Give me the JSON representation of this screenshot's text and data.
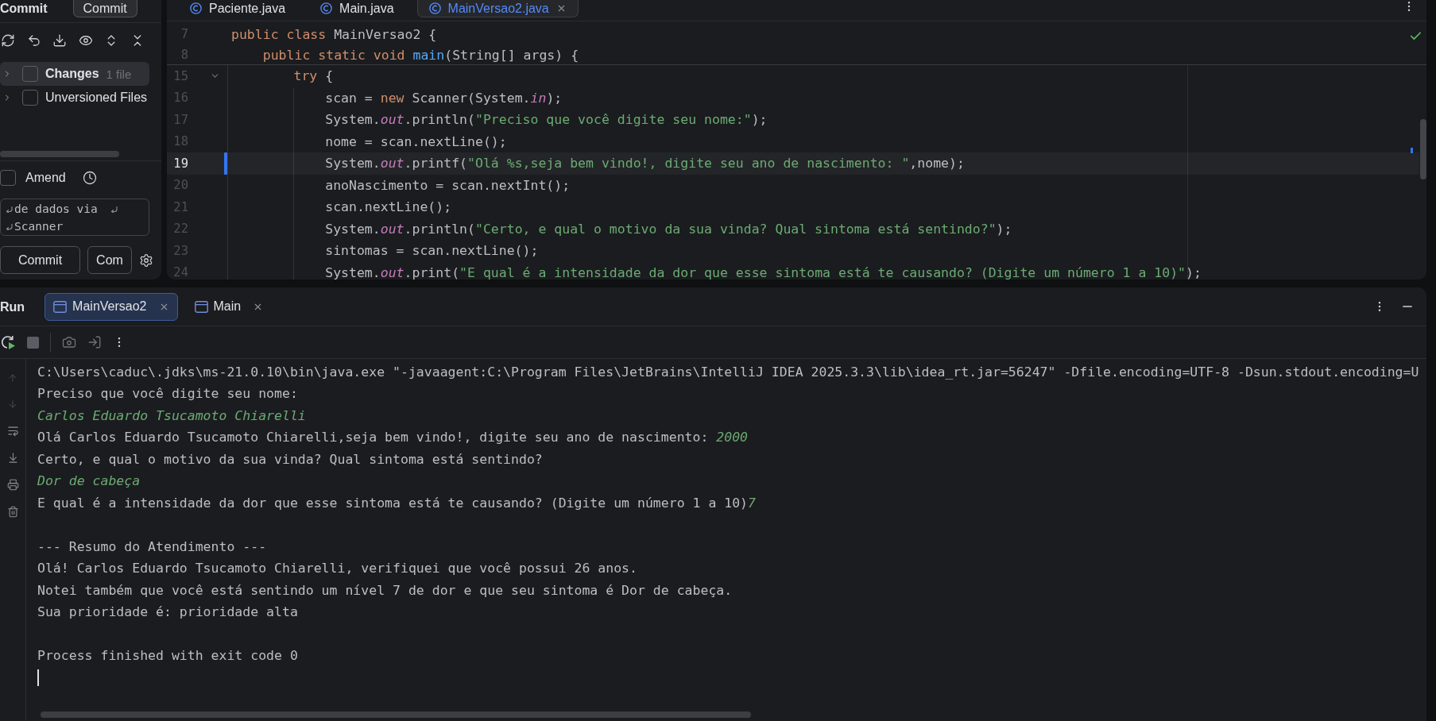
{
  "commit_panel": {
    "title": "Commit",
    "header_button": "Commit",
    "changelists": [
      {
        "label": "Changes",
        "count": "1 file",
        "selected": true,
        "checked": false,
        "expanded": false,
        "default": true
      },
      {
        "label": "Unversioned Files",
        "selected": false,
        "checked": false,
        "expanded": false,
        "default": false
      }
    ],
    "amend": {
      "label": "Amend",
      "checked": false
    },
    "message": {
      "lines": [
        "de dados via",
        "Scanner"
      ]
    },
    "buttons": [
      {
        "label": "Commit"
      },
      {
        "label": "Com"
      }
    ]
  },
  "editor": {
    "tabs": [
      {
        "label": "Paciente.java",
        "selected": false
      },
      {
        "label": "Main.java",
        "selected": false
      },
      {
        "label": "MainVersao2.java",
        "selected": true
      }
    ],
    "sticky_lines": [
      {
        "number": "7",
        "tokens": [
          {
            "text": "public class ",
            "kind": "keyword"
          },
          {
            "text": "MainVersao2 {",
            "kind": "plain"
          }
        ]
      },
      {
        "number": "8",
        "tokens": [
          {
            "text": "    public static void ",
            "kind": "keyword"
          },
          {
            "text": "main",
            "kind": "method"
          },
          {
            "text": "(String[] args) {",
            "kind": "plain"
          }
        ]
      }
    ],
    "lines": [
      {
        "number": "15",
        "current": false,
        "changed": false,
        "foldable": true,
        "tokens": [
          {
            "text": "        try",
            "kind": "keyword"
          },
          {
            "text": " {",
            "kind": "plain"
          }
        ]
      },
      {
        "number": "16",
        "current": false,
        "changed": false,
        "foldable": false,
        "tokens": [
          {
            "text": "            scan = ",
            "kind": "plain"
          },
          {
            "text": "new ",
            "kind": "keyword"
          },
          {
            "text": "Scanner(System.",
            "kind": "plain"
          },
          {
            "text": "in",
            "kind": "field"
          },
          {
            "text": ");",
            "kind": "plain"
          }
        ]
      },
      {
        "number": "17",
        "current": false,
        "changed": false,
        "foldable": false,
        "tokens": [
          {
            "text": "            System.",
            "kind": "plain"
          },
          {
            "text": "out",
            "kind": "field"
          },
          {
            "text": ".println(",
            "kind": "plain"
          },
          {
            "text": "\"Preciso que você digite seu nome:\"",
            "kind": "string"
          },
          {
            "text": ");",
            "kind": "plain"
          }
        ]
      },
      {
        "number": "18",
        "current": false,
        "changed": false,
        "foldable": false,
        "tokens": [
          {
            "text": "            nome = scan.nextLine();",
            "kind": "plain"
          }
        ]
      },
      {
        "number": "19",
        "current": true,
        "changed": true,
        "foldable": false,
        "tokens": [
          {
            "text": "            System.",
            "kind": "plain"
          },
          {
            "text": "out",
            "kind": "field"
          },
          {
            "text": ".printf(",
            "kind": "plain"
          },
          {
            "text": "\"Olá %s,seja bem vindo!, digite seu ano de nascimento: \"",
            "kind": "string"
          },
          {
            "text": ",nome);",
            "kind": "plain"
          }
        ]
      },
      {
        "number": "20",
        "current": false,
        "changed": false,
        "foldable": false,
        "tokens": [
          {
            "text": "            anoNascimento = scan.nextInt();",
            "kind": "plain"
          }
        ]
      },
      {
        "number": "21",
        "current": false,
        "changed": false,
        "foldable": false,
        "tokens": [
          {
            "text": "            scan.nextLine();",
            "kind": "plain"
          }
        ]
      },
      {
        "number": "22",
        "current": false,
        "changed": false,
        "foldable": false,
        "tokens": [
          {
            "text": "            System.",
            "kind": "plain"
          },
          {
            "text": "out",
            "kind": "field"
          },
          {
            "text": ".println(",
            "kind": "plain"
          },
          {
            "text": "\"Certo, e qual o motivo da sua vinda? Qual sintoma está sentindo?\"",
            "kind": "string"
          },
          {
            "text": ");",
            "kind": "plain"
          }
        ]
      },
      {
        "number": "23",
        "current": false,
        "changed": false,
        "foldable": false,
        "tokens": [
          {
            "text": "            sintomas = scan.nextLine();",
            "kind": "plain"
          }
        ]
      },
      {
        "number": "24",
        "current": false,
        "changed": false,
        "foldable": false,
        "tokens": [
          {
            "text": "            System.",
            "kind": "plain"
          },
          {
            "text": "out",
            "kind": "field"
          },
          {
            "text": ".print(",
            "kind": "plain"
          },
          {
            "text": "\"E qual é a intensidade da dor que esse sintoma está te causando? (Digite um número 1 a 10)\"",
            "kind": "string"
          },
          {
            "text": ");",
            "kind": "plain"
          }
        ]
      }
    ]
  },
  "run_panel": {
    "title": "Run",
    "tabs": [
      {
        "label": "MainVersao2",
        "selected": true
      },
      {
        "label": "Main",
        "selected": false
      }
    ],
    "console": {
      "caret": true,
      "blocks": [
        {
          "lines": [
            {
              "segments": [
                {
                  "text": "C:\\Users\\caduc\\.jdks\\ms-21.0.10\\bin\\java.exe \"-javaagent:C:\\Program Files\\JetBrains\\IntelliJ IDEA 2025.3.3\\lib\\idea_rt.jar=56247\" -Dfile.encoding=UTF-8 -Dsun.stdout.encoding=U",
                  "kind": "output"
                }
              ]
            },
            {
              "segments": [
                {
                  "text": "Preciso que você digite seu nome:",
                  "kind": "output"
                }
              ]
            },
            {
              "segments": [
                {
                  "text": "Carlos Eduardo Tsucamoto Chiarelli",
                  "kind": "input"
                }
              ]
            },
            {
              "segments": [
                {
                  "text": "Olá Carlos Eduardo Tsucamoto Chiarelli,seja bem vindo!, digite seu ano de nascimento: ",
                  "kind": "output"
                },
                {
                  "text": "2000",
                  "kind": "input"
                }
              ]
            },
            {
              "segments": [
                {
                  "text": "Certo, e qual o motivo da sua vinda? Qual sintoma está sentindo?",
                  "kind": "output"
                }
              ]
            },
            {
              "segments": [
                {
                  "text": "Dor de cabeça",
                  "kind": "input"
                }
              ]
            },
            {
              "segments": [
                {
                  "text": "E qual é a intensidade da dor que esse sintoma está te causando? (Digite um número 1 a 10)",
                  "kind": "output"
                },
                {
                  "text": "7",
                  "kind": "input"
                }
              ]
            }
          ]
        },
        {
          "lines": [
            {
              "segments": [
                {
                  "text": "--- Resumo do Atendimento ---",
                  "kind": "output"
                }
              ]
            },
            {
              "segments": [
                {
                  "text": "Olá! Carlos Eduardo Tsucamoto Chiarelli, verifiquei que você possui 26 anos.",
                  "kind": "output"
                }
              ]
            },
            {
              "segments": [
                {
                  "text": "Notei também que você está sentindo um nível 7 de dor e que seu sintoma é Dor de cabeça.",
                  "kind": "output"
                }
              ]
            },
            {
              "segments": [
                {
                  "text": "Sua prioridade é: prioridade alta",
                  "kind": "output"
                }
              ]
            }
          ]
        },
        {
          "lines": [
            {
              "segments": [
                {
                  "text": "Process finished with exit code 0",
                  "kind": "output"
                }
              ]
            }
          ]
        }
      ]
    }
  }
}
